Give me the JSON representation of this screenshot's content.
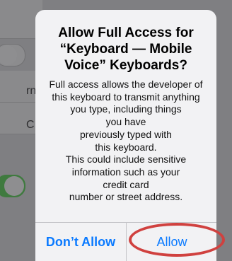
{
  "background": {
    "fragment_1": "rne",
    "fragment_2": "C"
  },
  "alert": {
    "title_lines": [
      "Allow Full Access for",
      "“Keyboard — Mobile",
      "Voice” Keyboards?"
    ],
    "message_lines": [
      "Full access allows the developer of",
      "this keyboard to transmit anything",
      "you type, including things",
      "you have",
      "previously typed with",
      "this keyboard.",
      "This could include sensitive",
      "information such as your",
      "credit card",
      "number or street address."
    ],
    "buttons": {
      "dont_allow_label": "Don’t Allow",
      "allow_label": "Allow"
    }
  },
  "colors": {
    "accent": "#0a7aff",
    "annotation": "#d0413f",
    "alert_bg": "#f2f2f4"
  }
}
